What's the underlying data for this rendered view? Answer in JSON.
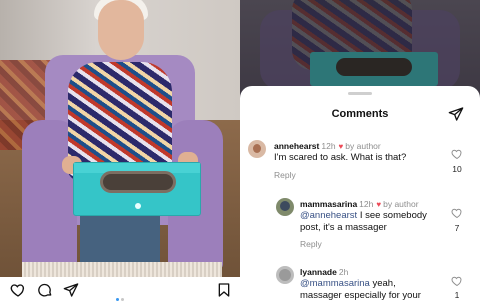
{
  "post": {
    "carousel": {
      "count": 2,
      "active": 0
    }
  },
  "action_bar": {
    "like_icon": "heart-outline-icon",
    "comment_icon": "comment-bubble-icon",
    "share_icon": "paper-plane-icon",
    "save_icon": "bookmark-icon"
  },
  "sheet": {
    "title": "Comments",
    "send_icon": "paper-plane-icon"
  },
  "comments": [
    {
      "username": "annehearst",
      "time": "12h",
      "liked_by_author": true,
      "by_author": "by author",
      "text": "I'm scared to ask. What is that?",
      "reply_label": "Reply",
      "likes": "10"
    },
    {
      "username": "mammasarina",
      "time": "12h",
      "liked_by_author": true,
      "by_author": "by author",
      "mention": "@annehearst",
      "text_after_mention": " I see somebody",
      "text_line2": "post, it's a massager",
      "reply_label": "Reply",
      "likes": "7"
    },
    {
      "username": "lyannade",
      "time": "2h",
      "mention": "@mammasarina",
      "text_after_mention": " yeah,",
      "text_line2": "massager especially for your",
      "likes": "1"
    }
  ],
  "colors": {
    "heart_red": "#ed4956",
    "mention_blue": "#385185",
    "carousel_active": "#3897f0",
    "secondary_text": "#8e8e8e"
  }
}
